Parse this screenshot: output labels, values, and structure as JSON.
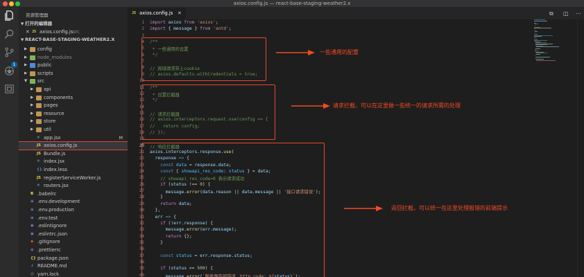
{
  "window": {
    "title": "axios.config.js — react-base-staging-weather2.x"
  },
  "activity_bar": {
    "icons": [
      "files-icon",
      "search-icon",
      "source-control-icon",
      "debug-icon",
      "extensions-icon"
    ],
    "scm_badge": "1"
  },
  "sidebar": {
    "title": "资源管理器",
    "open_editors": {
      "header": "打开的编辑器",
      "items": [
        {
          "close": "✕",
          "type": "JS",
          "name": "axios.config.js",
          "folder": "src"
        }
      ]
    },
    "project": {
      "header": "REACT-BASE-STAGING-WEATHER2.X",
      "tree": [
        {
          "name": "config",
          "kind": "folder",
          "indent": 1,
          "expanded": false,
          "color": "orange"
        },
        {
          "name": "node_modules",
          "kind": "folder",
          "indent": 1,
          "expanded": false,
          "color": "green",
          "dim": true
        },
        {
          "name": "public",
          "kind": "folder",
          "indent": 1,
          "expanded": false,
          "color": "blue"
        },
        {
          "name": "scripts",
          "kind": "folder",
          "indent": 1,
          "expanded": false,
          "color": "orange"
        },
        {
          "name": "src",
          "kind": "folder",
          "indent": 1,
          "expanded": true,
          "color": "green"
        },
        {
          "name": "api",
          "kind": "folder",
          "indent": 2,
          "expanded": false,
          "color": "orange"
        },
        {
          "name": "components",
          "kind": "folder",
          "indent": 2,
          "expanded": false,
          "color": "orange"
        },
        {
          "name": "pages",
          "kind": "folder",
          "indent": 2,
          "expanded": false,
          "color": "orange"
        },
        {
          "name": "resource",
          "kind": "folder",
          "indent": 2,
          "expanded": false,
          "color": "orange"
        },
        {
          "name": "store",
          "kind": "folder",
          "indent": 2,
          "expanded": false,
          "color": "orange"
        },
        {
          "name": "util",
          "kind": "folder",
          "indent": 2,
          "expanded": false,
          "color": "orange"
        },
        {
          "name": "app.jsx",
          "kind": "jsx",
          "indent": 2,
          "git": "M"
        },
        {
          "name": "axios.config.js",
          "kind": "js",
          "indent": 2,
          "selected": true
        },
        {
          "name": "Bundle.js",
          "kind": "js",
          "indent": 2
        },
        {
          "name": "index.jsx",
          "kind": "jsx",
          "indent": 2
        },
        {
          "name": "index.less",
          "kind": "less",
          "indent": 2
        },
        {
          "name": "registerServiceWorker.js",
          "kind": "js",
          "indent": 2
        },
        {
          "name": "routers.jsx",
          "kind": "jsx",
          "indent": 2
        },
        {
          "name": ".babelrc",
          "kind": "babel",
          "indent": 1
        },
        {
          "name": ".env.development",
          "kind": "env",
          "indent": 1
        },
        {
          "name": ".env.production",
          "kind": "env",
          "indent": 1
        },
        {
          "name": ".env.test",
          "kind": "env",
          "indent": 1
        },
        {
          "name": ".eslintignore",
          "kind": "eslint",
          "indent": 1
        },
        {
          "name": ".eslintrc.json",
          "kind": "eslint",
          "indent": 1
        },
        {
          "name": ".gitignore",
          "kind": "git",
          "indent": 1
        },
        {
          "name": ".prettierrc",
          "kind": "prettier",
          "indent": 1
        },
        {
          "name": "package.json",
          "kind": "json",
          "indent": 1
        },
        {
          "name": "README.md",
          "kind": "md",
          "indent": 1
        },
        {
          "name": "yarn.lock",
          "kind": "yarn",
          "indent": 1
        }
      ]
    }
  },
  "editor": {
    "tab": {
      "type": "JS",
      "name": "axios.config.js",
      "close": "✕"
    },
    "current_line": 20,
    "lines": [
      [
        [
          "kwc",
          "import "
        ],
        [
          "var",
          "axios "
        ],
        [
          "kwc",
          "from "
        ],
        [
          "str",
          "'axios'"
        ],
        [
          "",
          "; "
        ]
      ],
      [
        [
          "kwc",
          "import "
        ],
        [
          "",
          "{ "
        ],
        [
          "var",
          "message "
        ],
        [
          "",
          "} "
        ],
        [
          "kwc",
          "from "
        ],
        [
          "str",
          "'antd'"
        ],
        [
          "",
          ";"
        ]
      ],
      [],
      [
        [
          "cmt",
          "/**"
        ]
      ],
      [
        [
          "cmt",
          " * 一些通用的设置"
        ]
      ],
      [
        [
          "cmt",
          " */"
        ]
      ],
      [],
      [
        [
          "cmt",
          "// 跨域请求带上cookie"
        ]
      ],
      [
        [
          "cmt",
          "// axios.defaults.withCredentials = true;"
        ]
      ],
      [],
      [
        [
          "cmt",
          "/**"
        ]
      ],
      [
        [
          "cmt",
          " * 设置拦截器"
        ]
      ],
      [
        [
          "cmt",
          " */"
        ]
      ],
      [],
      [
        [
          "cmt",
          "// 请求拦截器"
        ]
      ],
      [
        [
          "cmt",
          "// axios.interceptors.request.use(config => {"
        ]
      ],
      [
        [
          "cmt",
          "//   return config;"
        ]
      ],
      [
        [
          "cmt",
          "// });"
        ]
      ],
      [],
      [
        [
          "cmt",
          "// 响应拦截器"
        ]
      ],
      [
        [
          "var",
          "axios"
        ],
        [
          "",
          "."
        ],
        [
          "var",
          "interceptors"
        ],
        [
          "",
          "."
        ],
        [
          "var",
          "response"
        ],
        [
          "",
          "."
        ],
        [
          "fn",
          "use"
        ],
        [
          "",
          "("
        ]
      ],
      [
        [
          "",
          "  "
        ],
        [
          "var",
          "response "
        ],
        [
          "kw",
          "=> "
        ],
        [
          "",
          "{"
        ]
      ],
      [
        [
          "",
          "    "
        ],
        [
          "kw",
          "const "
        ],
        [
          "cls",
          "data "
        ],
        [
          "",
          "= "
        ],
        [
          "var",
          "response"
        ],
        [
          "",
          "."
        ],
        [
          "var",
          "data"
        ],
        [
          "",
          ";"
        ]
      ],
      [
        [
          "",
          "    "
        ],
        [
          "kw",
          "const "
        ],
        [
          "",
          "{ "
        ],
        [
          "cls",
          "showapi_res_code"
        ],
        [
          "",
          ": "
        ],
        [
          "cls",
          "status "
        ],
        [
          "",
          "} = "
        ],
        [
          "var",
          "data"
        ],
        [
          "",
          ";"
        ]
      ],
      [
        [
          "",
          "    "
        ],
        [
          "cmt",
          "// showapi_res_code=0 表示请求成功"
        ]
      ],
      [
        [
          "",
          "    "
        ],
        [
          "kwc",
          "if "
        ],
        [
          "",
          "("
        ],
        [
          "var",
          "status "
        ],
        [
          "",
          "!== "
        ],
        [
          "num",
          "0"
        ],
        [
          "",
          ") {"
        ]
      ],
      [
        [
          "",
          "      "
        ],
        [
          "var",
          "message"
        ],
        [
          "",
          "."
        ],
        [
          "fn",
          "error"
        ],
        [
          "",
          "("
        ],
        [
          "var",
          "data"
        ],
        [
          "",
          "."
        ],
        [
          "var",
          "reason "
        ],
        [
          "",
          "|| "
        ],
        [
          "var",
          "data"
        ],
        [
          "",
          "."
        ],
        [
          "var",
          "message "
        ],
        [
          "",
          "|| "
        ],
        [
          "str",
          "'接口请求错误'"
        ],
        [
          "",
          ");"
        ]
      ],
      [
        [
          "",
          "    }"
        ]
      ],
      [
        [
          "",
          "    "
        ],
        [
          "kwc",
          "return "
        ],
        [
          "var",
          "data"
        ],
        [
          "",
          ";"
        ]
      ],
      [
        [
          "",
          "  },"
        ]
      ],
      [
        [
          "",
          "  "
        ],
        [
          "var",
          "err "
        ],
        [
          "kw",
          "=> "
        ],
        [
          "",
          "{"
        ]
      ],
      [
        [
          "",
          "    "
        ],
        [
          "kwc",
          "if "
        ],
        [
          "",
          "(!"
        ],
        [
          "var",
          "err"
        ],
        [
          "",
          "."
        ],
        [
          "var",
          "response"
        ],
        [
          "",
          ") {"
        ]
      ],
      [
        [
          "",
          "      "
        ],
        [
          "var",
          "message"
        ],
        [
          "",
          "."
        ],
        [
          "fn",
          "error"
        ],
        [
          "",
          "("
        ],
        [
          "var",
          "err"
        ],
        [
          "",
          "."
        ],
        [
          "var",
          "message"
        ],
        [
          "",
          ");"
        ]
      ],
      [
        [
          "",
          "      "
        ],
        [
          "kwc",
          "return "
        ],
        [
          "",
          "{};"
        ]
      ],
      [
        [
          "",
          "    }"
        ]
      ],
      [],
      [
        [
          "",
          "    "
        ],
        [
          "kw",
          "const "
        ],
        [
          "cls",
          "status "
        ],
        [
          "",
          "= "
        ],
        [
          "var",
          "err"
        ],
        [
          "",
          "."
        ],
        [
          "var",
          "response"
        ],
        [
          "",
          "."
        ],
        [
          "var",
          "status"
        ],
        [
          "",
          ";"
        ]
      ],
      [],
      [
        [
          "",
          "    "
        ],
        [
          "kwc",
          "if "
        ],
        [
          "",
          "("
        ],
        [
          "var",
          "status "
        ],
        [
          "",
          ">= "
        ],
        [
          "num",
          "500"
        ],
        [
          "",
          ") {"
        ]
      ],
      [
        [
          "",
          "      "
        ],
        [
          "var",
          "message"
        ],
        [
          "",
          "."
        ],
        [
          "fn",
          "error"
        ],
        [
          "",
          "("
        ],
        [
          "str",
          "`服务器内部错误，http code: ${"
        ],
        [
          "var",
          "status"
        ],
        [
          "str",
          "}`"
        ],
        [
          "",
          ");"
        ]
      ]
    ]
  },
  "annotations": [
    {
      "text": "一些通用的配置"
    },
    {
      "text": "请求拦截，可以在这里做一些统一的请求所需的处理"
    },
    {
      "text": "返回拦截，可以统一在这里处理报错的前端提示"
    }
  ],
  "colors": {
    "annotation": "#e6492d",
    "accent": "#0e639c"
  }
}
